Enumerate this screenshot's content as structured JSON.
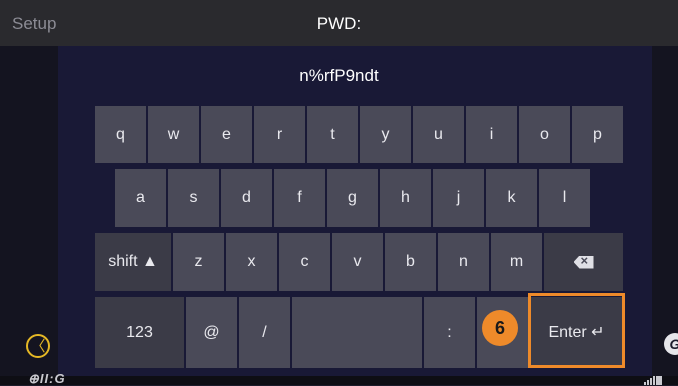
{
  "header": {
    "setup_label": "Setup",
    "pwd_label": "PWD:"
  },
  "password": {
    "value": "n%rfP9ndt"
  },
  "keyboard": {
    "row1": [
      "q",
      "w",
      "e",
      "r",
      "t",
      "y",
      "u",
      "i",
      "o",
      "p"
    ],
    "row2": [
      "a",
      "s",
      "d",
      "f",
      "g",
      "h",
      "j",
      "k",
      "l"
    ],
    "row3": [
      "shift ▲",
      "z",
      "x",
      "c",
      "v",
      "b",
      "n",
      "m"
    ],
    "row4": {
      "num": "123",
      "at": "@",
      "slash": "/",
      "colon": ":",
      "enter": "Enter ↵"
    },
    "backspace_icon": "backspace-icon"
  },
  "annotation": {
    "badge": "6",
    "color": "#ee8a2a"
  },
  "nav": {
    "back_icon": "back-circle-icon",
    "back_glyph": "〈"
  },
  "footer": {
    "logo": "⊕II:G",
    "right_icon_glyph": "G"
  }
}
